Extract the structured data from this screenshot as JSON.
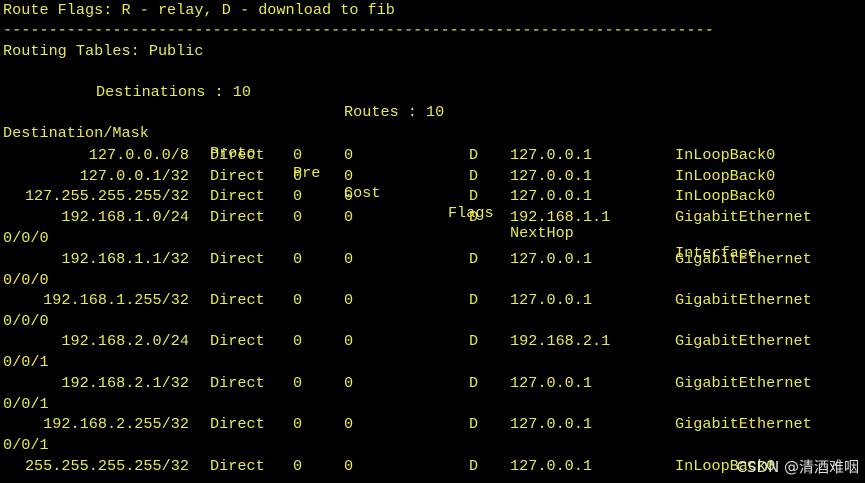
{
  "colors": {
    "background": "#000000",
    "foreground": "#e8e85a"
  },
  "header": {
    "flags_line": "Route Flags: R - relay, D - download to fib",
    "separator": "------------------------------------------------------------------------------",
    "routing_tables": "Routing Tables: Public",
    "destinations_label": "Destinations : 10",
    "routes_label": "Routes : 10"
  },
  "table": {
    "columns": [
      "Destination/Mask",
      "Proto",
      "Pre",
      "Cost",
      "Flags",
      "NextHop",
      "Interface"
    ],
    "rows": [
      {
        "dest": "127.0.0.0/8",
        "proto": "Direct",
        "pre": "0",
        "cost": "0",
        "flags": "D",
        "nexthop": "127.0.0.1",
        "iface": "InLoopBack0",
        "wrap": ""
      },
      {
        "dest": "127.0.0.1/32",
        "proto": "Direct",
        "pre": "0",
        "cost": "0",
        "flags": "D",
        "nexthop": "127.0.0.1",
        "iface": "InLoopBack0",
        "wrap": ""
      },
      {
        "dest": "127.255.255.255/32",
        "proto": "Direct",
        "pre": "0",
        "cost": "0",
        "flags": "D",
        "nexthop": "127.0.0.1",
        "iface": "InLoopBack0",
        "wrap": ""
      },
      {
        "dest": "192.168.1.0/24",
        "proto": "Direct",
        "pre": "0",
        "cost": "0",
        "flags": "D",
        "nexthop": "192.168.1.1",
        "iface": "GigabitEthernet",
        "wrap": "0/0/0"
      },
      {
        "dest": "192.168.1.1/32",
        "proto": "Direct",
        "pre": "0",
        "cost": "0",
        "flags": "D",
        "nexthop": "127.0.0.1",
        "iface": "GigabitEthernet",
        "wrap": "0/0/0"
      },
      {
        "dest": "192.168.1.255/32",
        "proto": "Direct",
        "pre": "0",
        "cost": "0",
        "flags": "D",
        "nexthop": "127.0.0.1",
        "iface": "GigabitEthernet",
        "wrap": "0/0/0"
      },
      {
        "dest": "192.168.2.0/24",
        "proto": "Direct",
        "pre": "0",
        "cost": "0",
        "flags": "D",
        "nexthop": "192.168.2.1",
        "iface": "GigabitEthernet",
        "wrap": "0/0/1"
      },
      {
        "dest": "192.168.2.1/32",
        "proto": "Direct",
        "pre": "0",
        "cost": "0",
        "flags": "D",
        "nexthop": "127.0.0.1",
        "iface": "GigabitEthernet",
        "wrap": "0/0/1"
      },
      {
        "dest": "192.168.2.255/32",
        "proto": "Direct",
        "pre": "0",
        "cost": "0",
        "flags": "D",
        "nexthop": "127.0.0.1",
        "iface": "GigabitEthernet",
        "wrap": "0/0/1"
      },
      {
        "dest": "255.255.255.255/32",
        "proto": "Direct",
        "pre": "0",
        "cost": "0",
        "flags": "D",
        "nexthop": "127.0.0.1",
        "iface": "InLoopBack0",
        "wrap": ""
      }
    ]
  },
  "watermark": "CSDN @清酒难咽"
}
